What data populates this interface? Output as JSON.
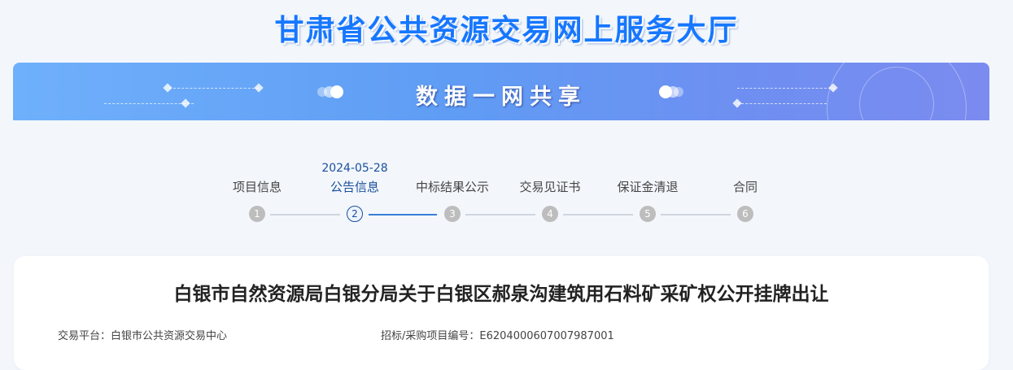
{
  "site_title": "甘肃省公共资源交易网上服务大厅",
  "banner_title": "数据一网共享",
  "steps": [
    {
      "num": "1",
      "label": "项目信息",
      "date": ""
    },
    {
      "num": "2",
      "label": "公告信息",
      "date": "2024-05-28"
    },
    {
      "num": "3",
      "label": "中标结果公示",
      "date": ""
    },
    {
      "num": "4",
      "label": "交易见证书",
      "date": ""
    },
    {
      "num": "5",
      "label": "保证金清退",
      "date": ""
    },
    {
      "num": "6",
      "label": "合同",
      "date": ""
    }
  ],
  "notice": {
    "title": "白银市自然资源局白银分局关于白银区郝泉沟建筑用石料矿采矿权公开挂牌出让",
    "platform_label": "交易平台：",
    "platform_value": "白银市公共资源交易中心",
    "project_no_label": "招标/采购项目编号：",
    "project_no_value": "E6204000607007987001"
  },
  "colors": {
    "title_blue": "#1677ff",
    "active_step": "#1a4f9c",
    "inactive_step": "#bdbdbd"
  }
}
